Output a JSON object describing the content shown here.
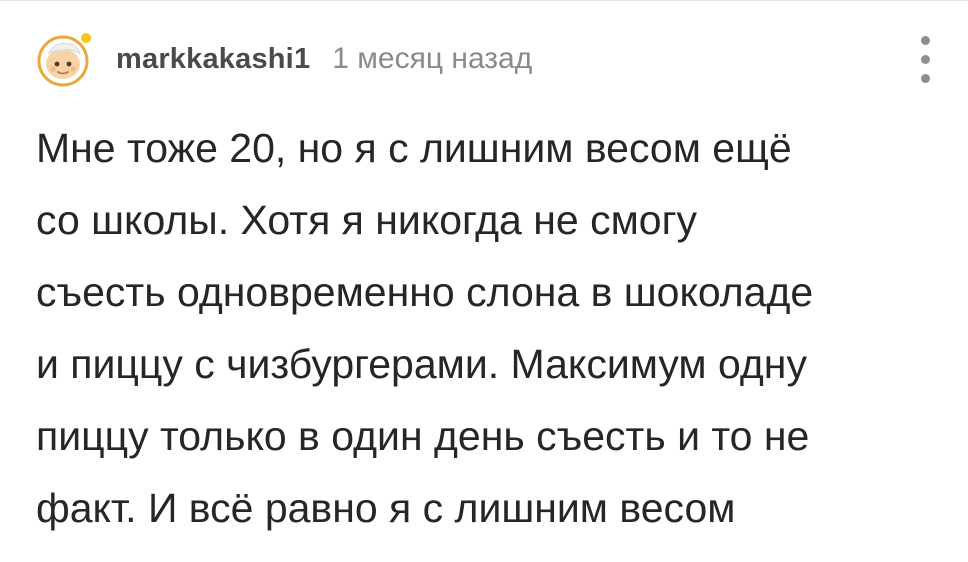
{
  "comment": {
    "author": {
      "username": "markkakashi1",
      "avatar_icon": "cartoon-face-avatar-icon",
      "online_indicator_color": "#f5c518"
    },
    "timestamp": "1 месяц назад",
    "menu_icon": "more-vertical-icon",
    "text_lines": [
      "Мне тоже 20, но я с лишним весом ещё",
      "со школы. Хотя я никогда не смогу",
      "съесть одновременно слона в шоколаде",
      "и пиццу с чизбургерами. Максимум одну",
      "пиццу только в один день съесть и то не",
      "факт. И всё равно я с лишним весом"
    ]
  },
  "colors": {
    "username": "#4a4a4a",
    "timestamp": "#8a8a8a",
    "body_text": "#262626",
    "menu_dots": "#8e8e8e",
    "avatar_ring": "#e9a93a"
  }
}
